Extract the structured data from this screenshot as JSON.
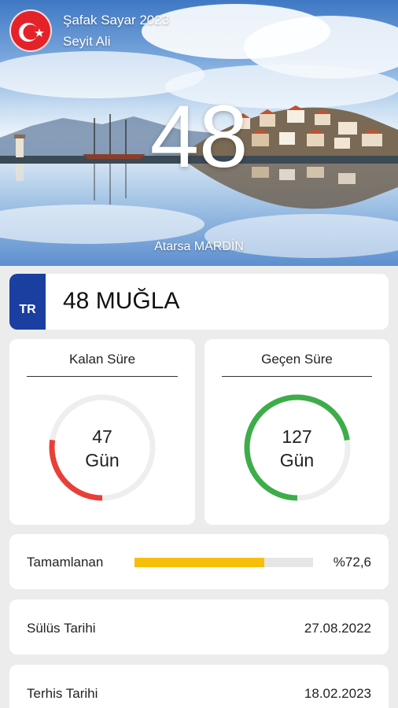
{
  "header": {
    "app_title": "Şafak Sayar 2023",
    "user_name": "Seyit Ali",
    "days_left_big": "48",
    "location": "Atarsa MARDİN"
  },
  "plate": {
    "country_code": "TR",
    "text": "48 MUĞLA",
    "band_color": "#1a3fa0"
  },
  "remaining": {
    "title": "Kalan Süre",
    "value": "47",
    "unit": "Gün",
    "fraction": 0.274,
    "color": "#e84038"
  },
  "elapsed": {
    "title": "Geçen Süre",
    "value": "127",
    "unit": "Gün",
    "fraction": 0.726,
    "color": "#3dad4a"
  },
  "progress": {
    "label": "Tamamlanan",
    "percent_text": "%72,6",
    "fraction": 0.726,
    "color": "#f5bf0a"
  },
  "dates": {
    "start_label": "Sülüs Tarihi",
    "start_value": "27.08.2022",
    "end_label": "Terhis Tarihi",
    "end_value": "18.02.2023"
  }
}
